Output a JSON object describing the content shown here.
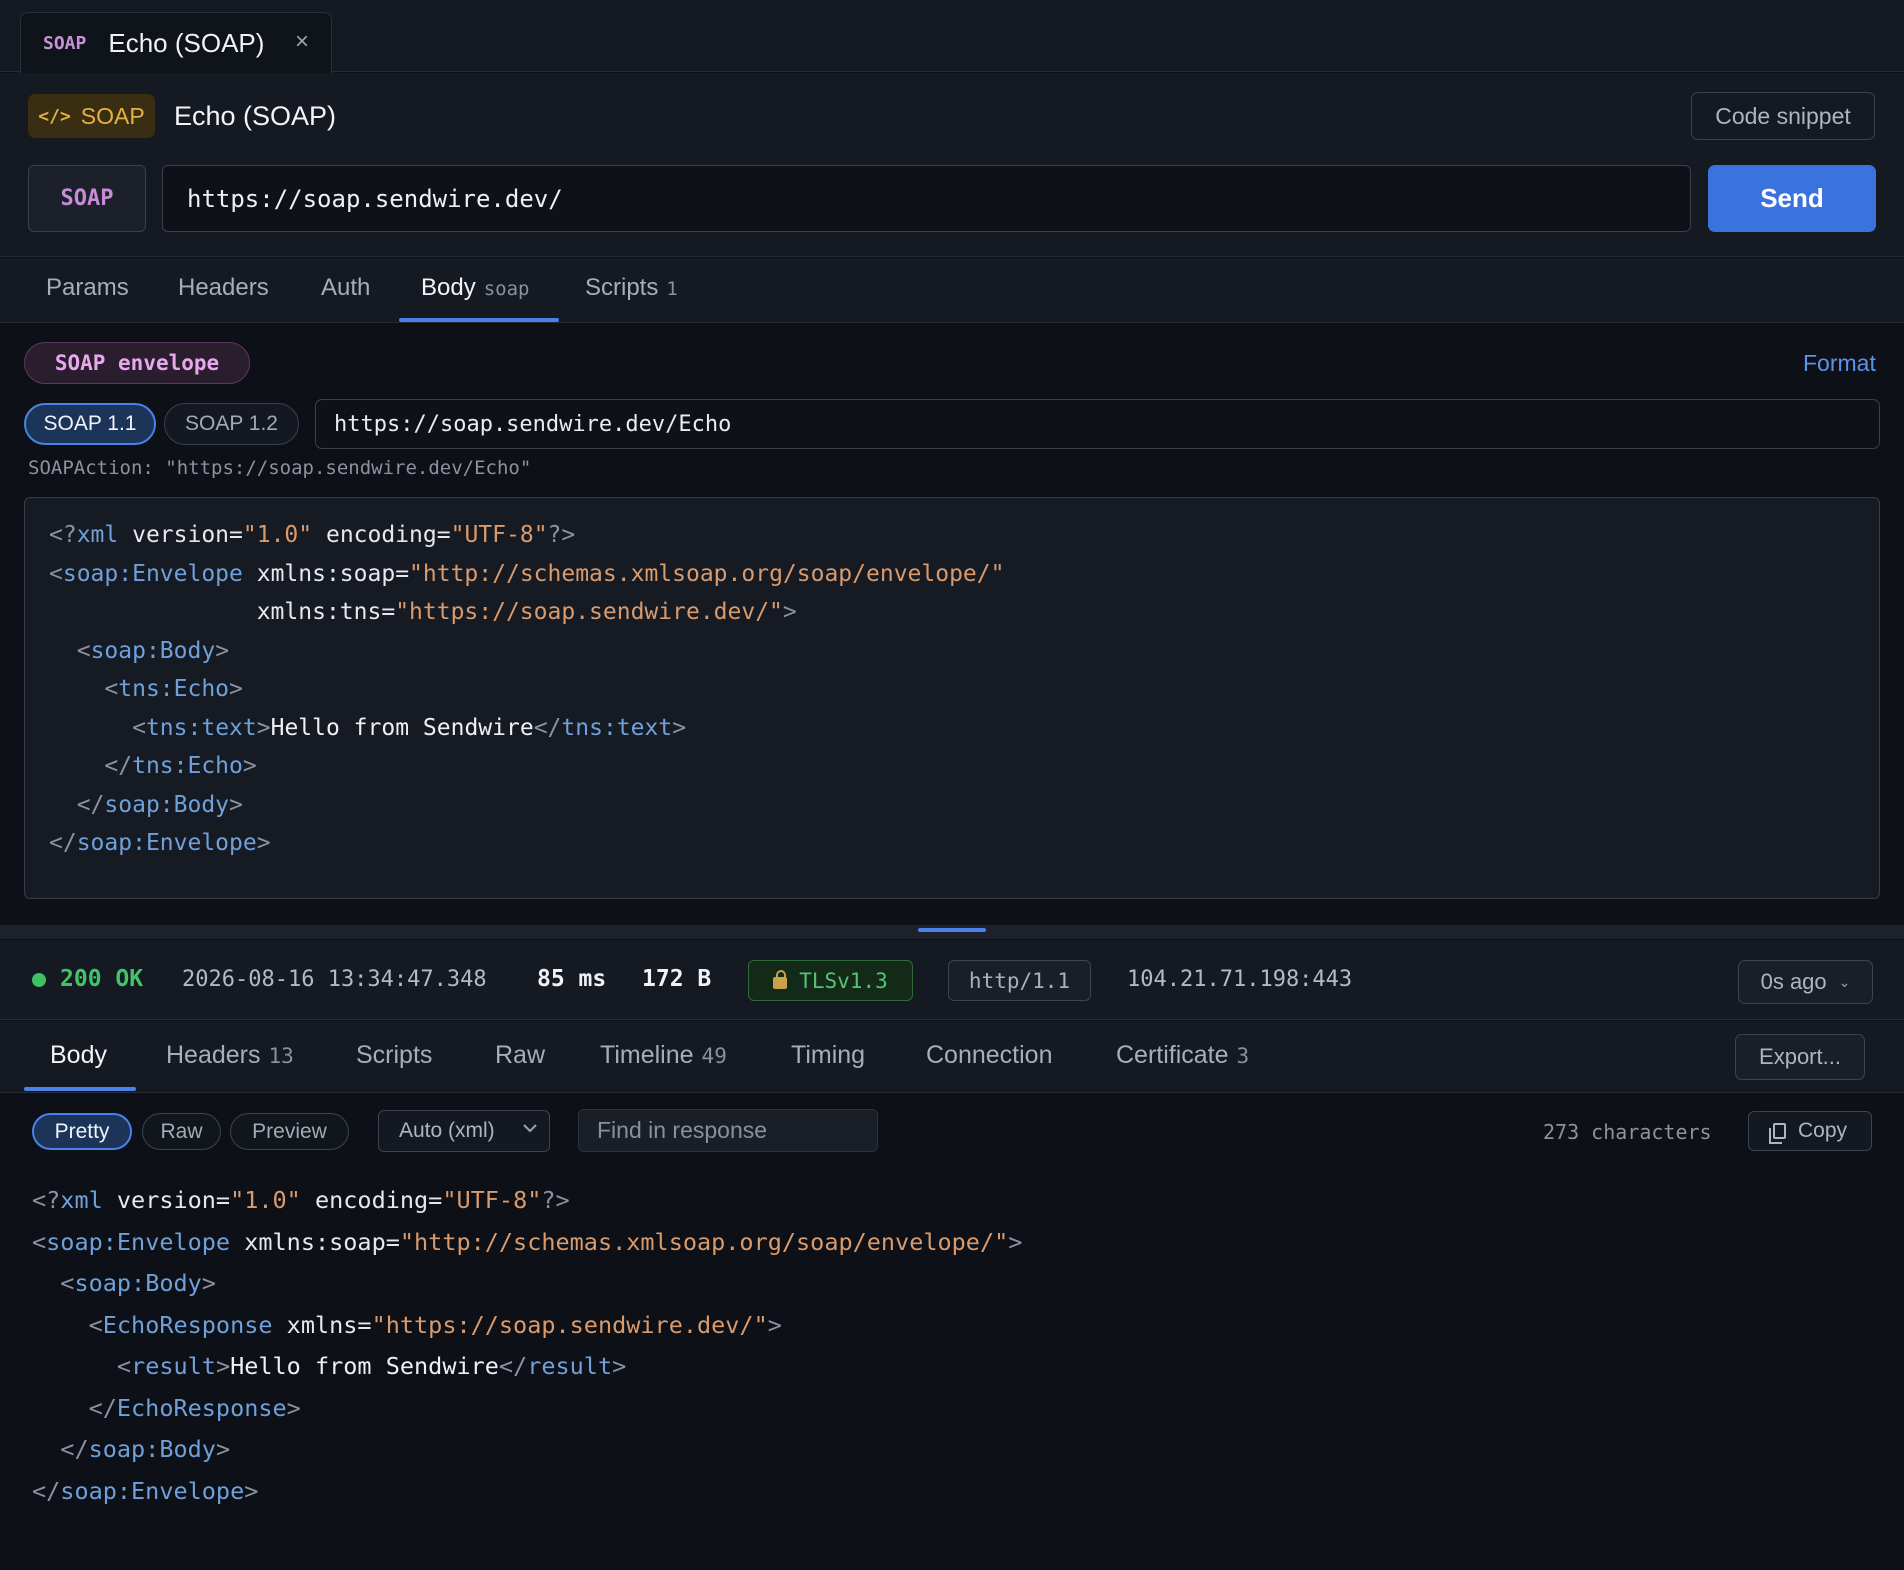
{
  "tab": {
    "method": "SOAP",
    "title": "Echo (SOAP)",
    "close": "×"
  },
  "header": {
    "badge_icon": "</>",
    "badge_label": "SOAP",
    "title": "Echo (SOAP)",
    "snippet_label": "Code snippet"
  },
  "url_bar": {
    "method": "SOAP",
    "url": "https://soap.sendwire.dev/",
    "send_label": "Send"
  },
  "request_tabs": [
    {
      "label": "Params",
      "sub": ""
    },
    {
      "label": "Headers",
      "sub": ""
    },
    {
      "label": "Auth",
      "sub": ""
    },
    {
      "label": "Body",
      "sub": "soap"
    },
    {
      "label": "Scripts",
      "sub": "1"
    }
  ],
  "body": {
    "envelope_badge": "SOAP envelope",
    "format_label": "Format",
    "version_11": "SOAP 1.1",
    "version_12": "SOAP 1.2",
    "action_value": "https://soap.sendwire.dev/Echo",
    "soapaction_line": "SOAPAction: \"https://soap.sendwire.dev/Echo\""
  },
  "request_xml": [
    [
      [
        "punc",
        "<?"
      ],
      [
        "tag",
        "xml"
      ],
      [
        "attr",
        " version="
      ],
      [
        "str",
        "\"1.0\""
      ],
      [
        "attr",
        " encoding="
      ],
      [
        "str",
        "\"UTF-8\""
      ],
      [
        "punc",
        "?>"
      ]
    ],
    [
      [
        "punc",
        "<"
      ],
      [
        "tag",
        "soap:Envelope"
      ],
      [
        "attr",
        " xmlns:soap="
      ],
      [
        "str",
        "\"http://schemas.xmlsoap.org/soap/envelope/\""
      ]
    ],
    [
      [
        "attr",
        "               xmlns:tns="
      ],
      [
        "str",
        "\"https://soap.sendwire.dev/\""
      ],
      [
        "punc",
        ">"
      ]
    ],
    [
      [
        "text",
        "  "
      ],
      [
        "punc",
        "<"
      ],
      [
        "tag",
        "soap:Body"
      ],
      [
        "punc",
        ">"
      ]
    ],
    [
      [
        "text",
        "    "
      ],
      [
        "punc",
        "<"
      ],
      [
        "tag",
        "tns:Echo"
      ],
      [
        "punc",
        ">"
      ]
    ],
    [
      [
        "text",
        "      "
      ],
      [
        "punc",
        "<"
      ],
      [
        "tag",
        "tns:text"
      ],
      [
        "punc",
        ">"
      ],
      [
        "text",
        "Hello from Sendwire"
      ],
      [
        "punc",
        "</"
      ],
      [
        "tag",
        "tns:text"
      ],
      [
        "punc",
        ">"
      ]
    ],
    [
      [
        "text",
        "    "
      ],
      [
        "punc",
        "</"
      ],
      [
        "tag",
        "tns:Echo"
      ],
      [
        "punc",
        ">"
      ]
    ],
    [
      [
        "text",
        "  "
      ],
      [
        "punc",
        "</"
      ],
      [
        "tag",
        "soap:Body"
      ],
      [
        "punc",
        ">"
      ]
    ],
    [
      [
        "punc",
        "</"
      ],
      [
        "tag",
        "soap:Envelope"
      ],
      [
        "punc",
        ">"
      ]
    ]
  ],
  "status": {
    "code_text": "200 OK",
    "timestamp": "2026-08-16 13:34:47.348",
    "duration": "85 ms",
    "size": "172 B",
    "tls": "TLSv1.3",
    "protocol": "http/1.1",
    "ip": "104.21.71.198:443",
    "ago": "0s ago",
    "ago_chevron": "⌄"
  },
  "response_tabs": [
    {
      "label": "Body",
      "count": ""
    },
    {
      "label": "Headers",
      "count": "13"
    },
    {
      "label": "Scripts",
      "count": ""
    },
    {
      "label": "Raw",
      "count": ""
    },
    {
      "label": "Timeline",
      "count": "49"
    },
    {
      "label": "Timing",
      "count": ""
    },
    {
      "label": "Connection",
      "count": ""
    },
    {
      "label": "Certificate",
      "count": "3"
    }
  ],
  "response_toolbar": {
    "export_label": "Export...",
    "pretty": "Pretty",
    "raw": "Raw",
    "preview": "Preview",
    "content_type": "Auto (xml)",
    "find_placeholder": "Find in response",
    "char_count": "273 characters",
    "copy_label": "Copy"
  },
  "response_xml": [
    [
      [
        "punc",
        "<?"
      ],
      [
        "tag",
        "xml"
      ],
      [
        "attr",
        " version="
      ],
      [
        "str",
        "\"1.0\""
      ],
      [
        "attr",
        " encoding="
      ],
      [
        "str",
        "\"UTF-8\""
      ],
      [
        "punc",
        "?>"
      ]
    ],
    [
      [
        "punc",
        "<"
      ],
      [
        "tag",
        "soap:Envelope"
      ],
      [
        "attr",
        " xmlns:soap="
      ],
      [
        "str",
        "\"http://schemas.xmlsoap.org/soap/envelope/\""
      ],
      [
        "punc",
        ">"
      ]
    ],
    [
      [
        "text",
        "  "
      ],
      [
        "punc",
        "<"
      ],
      [
        "tag",
        "soap:Body"
      ],
      [
        "punc",
        ">"
      ]
    ],
    [
      [
        "text",
        "    "
      ],
      [
        "punc",
        "<"
      ],
      [
        "tag",
        "EchoResponse"
      ],
      [
        "attr",
        " xmlns="
      ],
      [
        "str",
        "\"https://soap.sendwire.dev/\""
      ],
      [
        "punc",
        ">"
      ]
    ],
    [
      [
        "text",
        "      "
      ],
      [
        "punc",
        "<"
      ],
      [
        "tag",
        "result"
      ],
      [
        "punc",
        ">"
      ],
      [
        "text",
        "Hello from Sendwire"
      ],
      [
        "punc",
        "</"
      ],
      [
        "tag",
        "result"
      ],
      [
        "punc",
        ">"
      ]
    ],
    [
      [
        "text",
        "    "
      ],
      [
        "punc",
        "</"
      ],
      [
        "tag",
        "EchoResponse"
      ],
      [
        "punc",
        ">"
      ]
    ],
    [
      [
        "text",
        "  "
      ],
      [
        "punc",
        "</"
      ],
      [
        "tag",
        "soap:Body"
      ],
      [
        "punc",
        ">"
      ]
    ],
    [
      [
        "punc",
        "</"
      ],
      [
        "tag",
        "soap:Envelope"
      ],
      [
        "punc",
        ">"
      ]
    ]
  ]
}
